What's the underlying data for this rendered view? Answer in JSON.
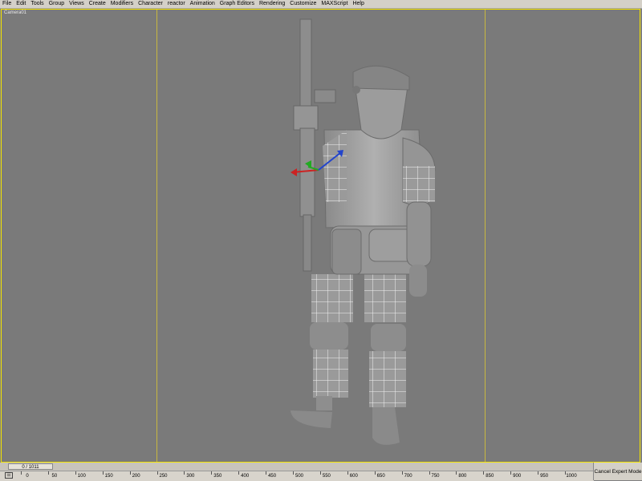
{
  "menu": [
    "File",
    "Edit",
    "Tools",
    "Group",
    "Views",
    "Create",
    "Modifiers",
    "Character",
    "reactor",
    "Animation",
    "Graph Editors",
    "Rendering",
    "Customize",
    "MAXScript",
    "Help"
  ],
  "viewport": {
    "label": "Camera01"
  },
  "timeline": {
    "frame_display": "0 / 1011",
    "ticks": [
      "0",
      "50",
      "100",
      "150",
      "200",
      "250",
      "300",
      "350",
      "400",
      "450",
      "500",
      "550",
      "600",
      "650",
      "700",
      "750",
      "800",
      "850",
      "900",
      "950",
      "1000"
    ]
  },
  "status": {
    "cancel_label": "Cancel Expert Mode"
  },
  "colors": {
    "viewport_border": "#f4e400",
    "background": "#7a7a7a"
  }
}
